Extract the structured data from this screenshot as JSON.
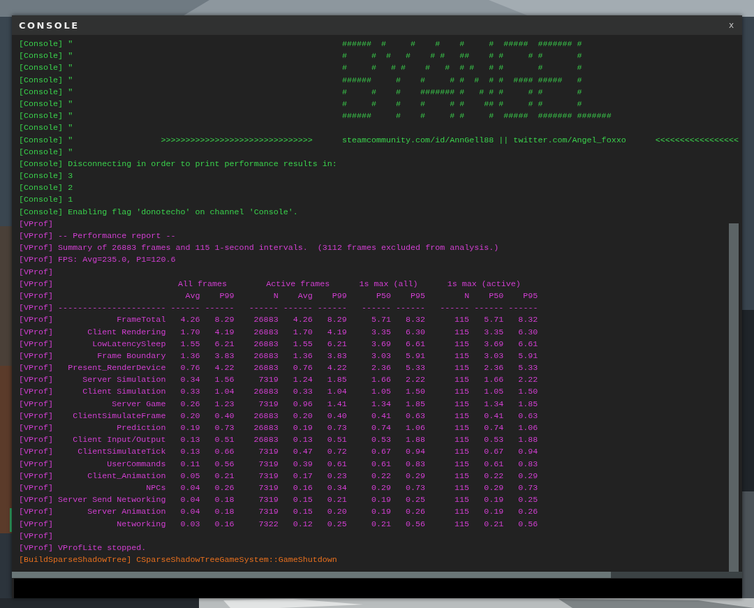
{
  "window": {
    "title": "CONSOLE",
    "close": "x"
  },
  "log": [
    {
      "kind": "art",
      "channel": "[Console]",
      "color": "#3ad14c",
      "quote": "\"",
      "art": "######  #     #    #    #     #  #####  ####### #"
    },
    {
      "kind": "art",
      "channel": "[Console]",
      "color": "#3ad14c",
      "quote": "\"",
      "art": "#     #  #   #    # #   ##    # #     # #       #"
    },
    {
      "kind": "art",
      "channel": "[Console]",
      "color": "#3ad14c",
      "quote": "\"",
      "art": "#     #   # #    #   #  # #   # #       #       #"
    },
    {
      "kind": "art",
      "channel": "[Console]",
      "color": "#3ad14c",
      "quote": "\"",
      "art": "######     #    #     # #  #  # #  #### #####   #"
    },
    {
      "kind": "art",
      "channel": "[Console]",
      "color": "#3ad14c",
      "quote": "\"",
      "art": "#     #    #    ####### #   # # #     # #       #"
    },
    {
      "kind": "art",
      "channel": "[Console]",
      "color": "#3ad14c",
      "quote": "\"",
      "art": "#     #    #    #     # #    ## #     # #       #"
    },
    {
      "kind": "art",
      "channel": "[Console]",
      "color": "#3ad14c",
      "quote": "\"",
      "art": "######     #    #     # #     #  #####  ####### #######"
    },
    {
      "kind": "text",
      "channel": "[Console]",
      "color": "#3ad14c",
      "text": "\""
    },
    {
      "kind": "links",
      "channel": "[Console]",
      "color": "#3ad14c",
      "quote": "\"",
      "arrows": ">>>>>>>>>>>>>>>>>>>>>>>>>>>>>>>",
      "links": "steamcommunity.com/id/AnnGell88 || twitter.com/Angel_foxxo",
      "arrows_end": "<<<<<<<<<<<<<<<<<"
    },
    {
      "kind": "text",
      "channel": "[Console]",
      "color": "#3ad14c",
      "text": "\""
    },
    {
      "kind": "text",
      "channel": "[Console]",
      "color": "#3ad14c",
      "text": "Disconnecting in order to print performance results in:"
    },
    {
      "kind": "text",
      "channel": "[Console]",
      "color": "#3ad14c",
      "text": "3"
    },
    {
      "kind": "text",
      "channel": "[Console]",
      "color": "#3ad14c",
      "text": "2"
    },
    {
      "kind": "text",
      "channel": "[Console]",
      "color": "#3ad14c",
      "text": "1"
    },
    {
      "kind": "text",
      "channel": "[Console]",
      "color": "#3ad14c",
      "text": "Enabling flag 'donotecho' on channel 'Console'."
    },
    {
      "kind": "text",
      "channel": "[VProf]",
      "color": "#d23fd2"
    },
    {
      "kind": "text",
      "channel": "[VProf]",
      "color": "#d23fd2",
      "text": "-- Performance report --"
    },
    {
      "kind": "text",
      "channel": "[VProf]",
      "color": "#d23fd2",
      "text": "Summary of 26883 frames and 115 1-second intervals.  (3112 frames excluded from analysis.)"
    },
    {
      "kind": "text",
      "channel": "[VProf]",
      "color": "#d23fd2",
      "text": "FPS: Avg=235.0, P1=120.6"
    },
    {
      "kind": "text",
      "channel": "[VProf]",
      "color": "#d23fd2"
    },
    {
      "kind": "group_header",
      "channel": "[VProf]",
      "color": "#d23fd2",
      "groups": [
        "All frames",
        "Active frames",
        "1s max (all)",
        "1s max (active)"
      ]
    },
    {
      "kind": "column_header",
      "channel": "[VProf]",
      "color": "#d23fd2",
      "columns": [
        "Avg",
        "P99",
        "N",
        "Avg",
        "P99",
        "P50",
        "P95",
        "N",
        "P50",
        "P95"
      ]
    },
    {
      "kind": "rule",
      "channel": "[VProf]",
      "color": "#d23fd2",
      "text": "---------------------- ------ ------   ------ ------ ------   ------ ------   ------ ------ ------"
    },
    {
      "kind": "row",
      "channel": "[VProf]",
      "color": "#d23fd2",
      "name": "FrameTotal",
      "values": [
        "4.26",
        "8.29",
        "26883",
        "4.26",
        "8.29",
        "5.71",
        "8.32",
        "115",
        "5.71",
        "8.32"
      ]
    },
    {
      "kind": "row",
      "channel": "[VProf]",
      "color": "#d23fd2",
      "name": "Client Rendering",
      "values": [
        "1.70",
        "4.19",
        "26883",
        "1.70",
        "4.19",
        "3.35",
        "6.30",
        "115",
        "3.35",
        "6.30"
      ]
    },
    {
      "kind": "row",
      "channel": "[VProf]",
      "color": "#d23fd2",
      "name": "LowLatencySleep",
      "values": [
        "1.55",
        "6.21",
        "26883",
        "1.55",
        "6.21",
        "3.69",
        "6.61",
        "115",
        "3.69",
        "6.61"
      ]
    },
    {
      "kind": "row",
      "channel": "[VProf]",
      "color": "#d23fd2",
      "name": "Frame Boundary",
      "values": [
        "1.36",
        "3.83",
        "26883",
        "1.36",
        "3.83",
        "3.03",
        "5.91",
        "115",
        "3.03",
        "5.91"
      ]
    },
    {
      "kind": "row",
      "channel": "[VProf]",
      "color": "#d23fd2",
      "name": "Present_RenderDevice",
      "values": [
        "0.76",
        "4.22",
        "26883",
        "0.76",
        "4.22",
        "2.36",
        "5.33",
        "115",
        "2.36",
        "5.33"
      ]
    },
    {
      "kind": "row",
      "channel": "[VProf]",
      "color": "#d23fd2",
      "name": "Server Simulation",
      "values": [
        "0.34",
        "1.56",
        "7319",
        "1.24",
        "1.85",
        "1.66",
        "2.22",
        "115",
        "1.66",
        "2.22"
      ]
    },
    {
      "kind": "row",
      "channel": "[VProf]",
      "color": "#d23fd2",
      "name": "Client Simulation",
      "values": [
        "0.33",
        "1.04",
        "26883",
        "0.33",
        "1.04",
        "1.05",
        "1.50",
        "115",
        "1.05",
        "1.50"
      ]
    },
    {
      "kind": "row",
      "channel": "[VProf]",
      "color": "#d23fd2",
      "name": "Server Game",
      "values": [
        "0.26",
        "1.23",
        "7319",
        "0.96",
        "1.41",
        "1.34",
        "1.85",
        "115",
        "1.34",
        "1.85"
      ]
    },
    {
      "kind": "row",
      "channel": "[VProf]",
      "color": "#d23fd2",
      "name": "ClientSimulateFrame",
      "values": [
        "0.20",
        "0.40",
        "26883",
        "0.20",
        "0.40",
        "0.41",
        "0.63",
        "115",
        "0.41",
        "0.63"
      ]
    },
    {
      "kind": "row",
      "channel": "[VProf]",
      "color": "#d23fd2",
      "name": "Prediction",
      "values": [
        "0.19",
        "0.73",
        "26883",
        "0.19",
        "0.73",
        "0.74",
        "1.06",
        "115",
        "0.74",
        "1.06"
      ]
    },
    {
      "kind": "row",
      "channel": "[VProf]",
      "color": "#d23fd2",
      "name": "Client Input/Output",
      "values": [
        "0.13",
        "0.51",
        "26883",
        "0.13",
        "0.51",
        "0.53",
        "1.88",
        "115",
        "0.53",
        "1.88"
      ]
    },
    {
      "kind": "row",
      "channel": "[VProf]",
      "color": "#d23fd2",
      "name": "ClientSimulateTick",
      "values": [
        "0.13",
        "0.66",
        "7319",
        "0.47",
        "0.72",
        "0.67",
        "0.94",
        "115",
        "0.67",
        "0.94"
      ]
    },
    {
      "kind": "row",
      "channel": "[VProf]",
      "color": "#d23fd2",
      "name": "UserCommands",
      "values": [
        "0.11",
        "0.56",
        "7319",
        "0.39",
        "0.61",
        "0.61",
        "0.83",
        "115",
        "0.61",
        "0.83"
      ]
    },
    {
      "kind": "row",
      "channel": "[VProf]",
      "color": "#d23fd2",
      "name": "Client_Animation",
      "values": [
        "0.05",
        "0.21",
        "7319",
        "0.17",
        "0.23",
        "0.22",
        "0.29",
        "115",
        "0.22",
        "0.29"
      ]
    },
    {
      "kind": "row",
      "channel": "[VProf]",
      "color": "#d23fd2",
      "name": "NPCs",
      "values": [
        "0.04",
        "0.26",
        "7319",
        "0.16",
        "0.34",
        "0.29",
        "0.73",
        "115",
        "0.29",
        "0.73"
      ]
    },
    {
      "kind": "row",
      "channel": "[VProf]",
      "color": "#d23fd2",
      "name": "Server Send Networking",
      "values": [
        "0.04",
        "0.18",
        "7319",
        "0.15",
        "0.21",
        "0.19",
        "0.25",
        "115",
        "0.19",
        "0.25"
      ]
    },
    {
      "kind": "row",
      "channel": "[VProf]",
      "color": "#d23fd2",
      "name": "Server Animation",
      "values": [
        "0.04",
        "0.18",
        "7319",
        "0.15",
        "0.20",
        "0.19",
        "0.26",
        "115",
        "0.19",
        "0.26"
      ]
    },
    {
      "kind": "row",
      "channel": "[VProf]",
      "color": "#d23fd2",
      "name": "Networking",
      "values": [
        "0.03",
        "0.16",
        "7322",
        "0.12",
        "0.25",
        "0.21",
        "0.56",
        "115",
        "0.21",
        "0.56"
      ]
    },
    {
      "kind": "text",
      "channel": "[VProf]",
      "color": "#d23fd2"
    },
    {
      "kind": "text",
      "channel": "[VProf]",
      "color": "#d23fd2",
      "text": "VProfLite stopped."
    },
    {
      "kind": "text",
      "channel": "[BuildSparseShadowTree]",
      "color": "#e8701e",
      "text": "CSparseShadowTreeGameSystem::GameShutdown"
    }
  ]
}
